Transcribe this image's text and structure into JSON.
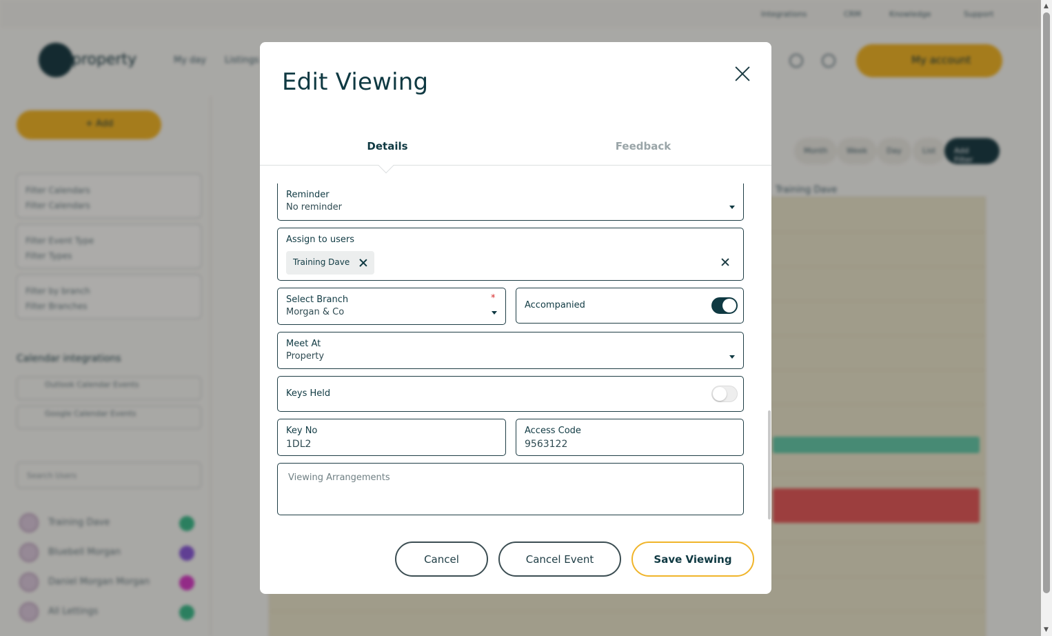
{
  "background": {
    "topbar_links": [
      "Integrations",
      "CRM",
      "Knowledge",
      "Support"
    ],
    "logo_text": "property",
    "nav_links": [
      "My day",
      "Listings"
    ],
    "account_button": "My account",
    "add_button": "+ Add",
    "filters": [
      {
        "label": "Filter Calendars",
        "value": "Filter Calendars"
      },
      {
        "label": "Filter Event Type",
        "value": "Filter Types"
      },
      {
        "label": "Filter by branch",
        "value": "Filter Branches"
      }
    ],
    "calendar_integrations_title": "Calendar integrations",
    "calendar_integrations": [
      "Outlook Calendar Events",
      "Google Calendar Events"
    ],
    "search_users_placeholder": "Search Users",
    "users": [
      {
        "name": "Training Dave",
        "color": "#3fb98a"
      },
      {
        "name": "Bluebell Morgan",
        "color": "#8b5cd6"
      },
      {
        "name": "Daniel Morgan Morgan",
        "color": "#d63fc4"
      },
      {
        "name": "All Lettings",
        "color": "#3fb98a"
      }
    ],
    "view_buttons": [
      "Month",
      "Week",
      "Day",
      "List",
      "Add Filter"
    ],
    "calendar_column_title": "Training Dave"
  },
  "modal": {
    "title": "Edit Viewing",
    "tabs": [
      {
        "label": "Details",
        "active": true
      },
      {
        "label": "Feedback",
        "active": false
      }
    ],
    "reminder": {
      "label": "Reminder",
      "value": "No reminder"
    },
    "assign_users": {
      "label": "Assign to users",
      "chips": [
        "Training Dave"
      ]
    },
    "branch": {
      "label": "Select Branch",
      "value": "Morgan & Co",
      "required_mark": "*"
    },
    "accompanied": {
      "label": "Accompanied",
      "on": true
    },
    "meet_at": {
      "label": "Meet At",
      "value": "Property"
    },
    "keys_held": {
      "label": "Keys Held",
      "on": false
    },
    "key_no": {
      "label": "Key No",
      "value": "1DL2"
    },
    "access_code": {
      "label": "Access Code",
      "value": "9563122"
    },
    "viewing_arrangements": {
      "placeholder": "Viewing Arrangements",
      "value": ""
    },
    "buttons": {
      "cancel": "Cancel",
      "cancel_event": "Cancel Event",
      "save": "Save Viewing"
    }
  },
  "colors": {
    "primary_dark": "#0f3942",
    "accent_yellow": "#f0b429",
    "required_red": "#d62a2a"
  }
}
